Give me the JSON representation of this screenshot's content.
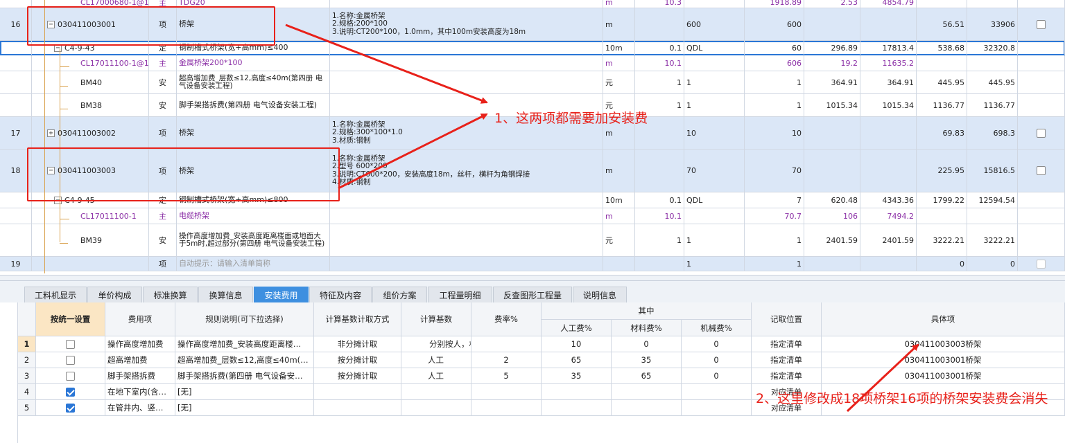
{
  "upper": {
    "rows": [
      {
        "num": "",
        "expander": "",
        "code": "CL17000680-1@1",
        "type": "主",
        "name": "TDG20",
        "feat": [],
        "unit": "m",
        "coef": "10.3",
        "qexp": "",
        "qty": "1918.89",
        "price": "2.53",
        "total": "4854.79",
        "uprice": "",
        "utotal": "",
        "purple": true,
        "hl": false,
        "check": false
      },
      {
        "num": "16",
        "expander": "−",
        "code": "030411003001",
        "type": "项",
        "name": "桥架",
        "feat": [
          "1.名称:金属桥架",
          "2.规格:200*100",
          "3.说明:CT200*100，1.0mm，其中100m安装高度为18m"
        ],
        "unit": "m",
        "coef": "",
        "qexp": "600",
        "qty": "600",
        "price": "",
        "total": "",
        "uprice": "56.51",
        "utotal": "33906",
        "purple": false,
        "hl": true,
        "check": true
      },
      {
        "num": "",
        "expander": "−",
        "code": "C4-9-43",
        "type": "定",
        "name": "钢制槽式桥架(宽+高mm)≤400",
        "feat": [],
        "unit": "10m",
        "coef": "0.1",
        "qexp": "QDL",
        "qty": "60",
        "price": "296.89",
        "total": "17813.4",
        "uprice": "538.68",
        "utotal": "32320.8",
        "purple": false,
        "hl": false,
        "sel": true,
        "check": false
      },
      {
        "num": "",
        "expander": "",
        "code": "CL17011100-1@1",
        "type": "主",
        "name": "金属桥架200*100",
        "feat": [],
        "unit": "m",
        "coef": "10.1",
        "qexp": "",
        "qty": "606",
        "price": "19.2",
        "total": "11635.2",
        "uprice": "",
        "utotal": "",
        "purple": true,
        "hl": false,
        "check": false
      },
      {
        "num": "",
        "expander": "",
        "code": "BM40",
        "type": "安",
        "name": "超高增加费_层数≤12,高度≤40m(第四册 电气设备安装工程)",
        "feat": [],
        "unit": "元",
        "coef": "1",
        "qexp": "1",
        "qty": "1",
        "price": "364.91",
        "total": "364.91",
        "uprice": "445.95",
        "utotal": "445.95",
        "purple": false,
        "hl": false,
        "check": false
      },
      {
        "num": "",
        "expander": "",
        "code": "BM38",
        "type": "安",
        "name": "脚手架搭拆费(第四册 电气设备安装工程)",
        "feat": [],
        "unit": "元",
        "coef": "1",
        "qexp": "1",
        "qty": "1",
        "price": "1015.34",
        "total": "1015.34",
        "uprice": "1136.77",
        "utotal": "1136.77",
        "purple": false,
        "hl": false,
        "check": false
      },
      {
        "num": "17",
        "expander": "+",
        "code": "030411003002",
        "type": "项",
        "name": "桥架",
        "feat": [
          "1.名称:金属桥架",
          "2.规格:300*100*1.0",
          "3.材质:钢制"
        ],
        "unit": "m",
        "coef": "",
        "qexp": "10",
        "qty": "10",
        "price": "",
        "total": "",
        "uprice": "69.83",
        "utotal": "698.3",
        "purple": false,
        "hl": true,
        "check": true
      },
      {
        "num": "18",
        "expander": "−",
        "code": "030411003003",
        "type": "项",
        "name": "桥架",
        "feat": [
          "1.名称:金属桥架",
          "2.型号 600*200",
          "3.说明:CT600*200，安装高度18m，丝杆，横杆为角钢焊接",
          "4.材质:钢制"
        ],
        "unit": "m",
        "coef": "",
        "qexp": "70",
        "qty": "70",
        "price": "",
        "total": "",
        "uprice": "225.95",
        "utotal": "15816.5",
        "purple": false,
        "hl": true,
        "check": true
      },
      {
        "num": "",
        "expander": "−",
        "code": "C4-9-45",
        "type": "定",
        "name": "钢制槽式桥架(宽+高mm)≤800",
        "feat": [],
        "unit": "10m",
        "coef": "0.1",
        "qexp": "QDL",
        "qty": "7",
        "price": "620.48",
        "total": "4343.36",
        "uprice": "1799.22",
        "utotal": "12594.54",
        "purple": false,
        "hl": false,
        "check": false
      },
      {
        "num": "",
        "expander": "",
        "code": "CL17011100-1",
        "type": "主",
        "name": "电缆桥架",
        "feat": [],
        "unit": "m",
        "coef": "10.1",
        "qexp": "",
        "qty": "70.7",
        "price": "106",
        "total": "7494.2",
        "uprice": "",
        "utotal": "",
        "purple": true,
        "hl": false,
        "check": false
      },
      {
        "num": "",
        "expander": "",
        "code": "BM39",
        "type": "安",
        "name": "操作高度增加费_安装高度距离楼面或地面大于5m时,超过部分(第四册 电气设备安装工程)",
        "feat": [],
        "unit": "元",
        "coef": "1",
        "qexp": "1",
        "qty": "1",
        "price": "2401.59",
        "total": "2401.59",
        "uprice": "3222.21",
        "utotal": "3222.21",
        "purple": false,
        "hl": false,
        "check": false
      },
      {
        "num": "19",
        "expander": "",
        "code": "",
        "type": "项",
        "name": "自动提示：请输入清单简称",
        "feat": [],
        "unit": "",
        "coef": "",
        "qexp": "1",
        "qty": "1",
        "price": "",
        "total": "",
        "uprice": "0",
        "utotal": "0",
        "purple": false,
        "hl": true,
        "gray": true,
        "check": true
      }
    ]
  },
  "tabs": [
    "工料机显示",
    "单价构成",
    "标准换算",
    "换算信息",
    "安装费用",
    "特征及内容",
    "组价方案",
    "工程量明细",
    "反查图形工程量",
    "说明信息"
  ],
  "active_tab": "安装费用",
  "lower": {
    "headers": {
      "setting": "按统一设置",
      "fee_item": "费用项",
      "rule": "规则说明(可下拉选择)",
      "calc_method": "计算基数计取方式",
      "calc_base": "计算基数",
      "rate": "费率%",
      "group": "其中",
      "labor": "人工费%",
      "material": "材料费%",
      "machine": "机械费%",
      "position": "记取位置",
      "specific": "具体项"
    },
    "rows": [
      {
        "num": "1",
        "checked": false,
        "fee_item": "操作高度增加费",
        "rule": "操作高度增加费_安装高度距离楼…",
        "calc_method": "非分摊计取",
        "calc_base": "分别按人，材，机取费",
        "rate": "",
        "labor": "10",
        "material": "0",
        "machine": "0",
        "position": "指定清单",
        "specific": "030411003003桥架"
      },
      {
        "num": "2",
        "checked": false,
        "fee_item": "超高增加费",
        "rule": "超高增加费_层数≤12,高度≤40m(…",
        "calc_method": "按分摊计取",
        "calc_base": "人工",
        "rate": "2",
        "labor": "65",
        "material": "35",
        "machine": "0",
        "position": "指定清单",
        "specific": "030411003001桥架"
      },
      {
        "num": "3",
        "checked": false,
        "fee_item": "脚手架搭拆费",
        "rule": "脚手架搭拆费(第四册 电气设备安…",
        "calc_method": "按分摊计取",
        "calc_base": "人工",
        "rate": "5",
        "labor": "35",
        "material": "65",
        "machine": "0",
        "position": "指定清单",
        "specific": "030411003001桥架"
      },
      {
        "num": "4",
        "checked": true,
        "fee_item": "在地下室内(含…",
        "rule": "[无]",
        "calc_method": "",
        "calc_base": "",
        "rate": "",
        "labor": "",
        "material": "",
        "machine": "",
        "position": "对应清单",
        "specific": ""
      },
      {
        "num": "5",
        "checked": true,
        "fee_item": "在管井内、竖…",
        "rule": "[无]",
        "calc_method": "",
        "calc_base": "",
        "rate": "",
        "labor": "",
        "material": "",
        "machine": "",
        "position": "对应清单",
        "specific": ""
      }
    ]
  },
  "annotations": {
    "note1": "1、这两项都需要加安装费",
    "note2": "2、这里修改成18项桥架16项的桥架安装费会消失",
    "color": "#e8211a"
  }
}
